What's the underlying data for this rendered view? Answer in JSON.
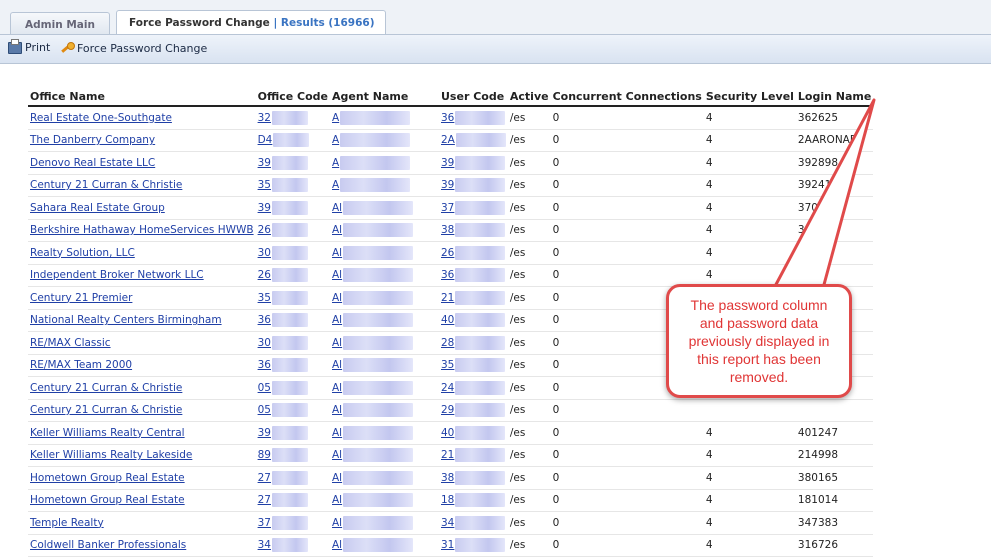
{
  "tabs": [
    {
      "label": "Admin Main"
    },
    {
      "label": "Force Password Change",
      "results": "| Results (16966)",
      "close": "✕"
    }
  ],
  "toolbar": {
    "print_label": "Print",
    "force_label": "Force Password Change"
  },
  "table": {
    "headers": [
      "Office Name",
      "Office Code",
      "Agent Name",
      "User Code",
      "Active",
      "Concurrent Connections",
      "Security Level",
      "Login Name"
    ],
    "rows": [
      {
        "office": "Real Estate One-Southgate",
        "code": "32",
        "agent": "A",
        "user": "36",
        "active": "/es",
        "conc": "0",
        "sec": "4",
        "login": "362625"
      },
      {
        "office": "The Danberry Company",
        "code": "D4",
        "agent": "A",
        "user": "2A",
        "active": "/es",
        "conc": "0",
        "sec": "4",
        "login": "2AARONAD"
      },
      {
        "office": "Denovo Real Estate LLC",
        "code": "39",
        "agent": "A",
        "user": "39",
        "active": "/es",
        "conc": "0",
        "sec": "4",
        "login": "392898"
      },
      {
        "office": "Century 21 Curran & Christie",
        "code": "35",
        "agent": "A",
        "user": "39",
        "active": "/es",
        "conc": "0",
        "sec": "4",
        "login": "392415"
      },
      {
        "office": "Sahara Real Estate Group",
        "code": "39",
        "agent": "Al",
        "user": "37",
        "active": "/es",
        "conc": "0",
        "sec": "4",
        "login": "370635"
      },
      {
        "office": "Berkshire Hathaway HomeServices HWWB",
        "code": "26",
        "agent": "Al",
        "user": "38",
        "active": "/es",
        "conc": "0",
        "sec": "4",
        "login": "3868"
      },
      {
        "office": "Realty Solution, LLC",
        "code": "30",
        "agent": "Al",
        "user": "26",
        "active": "/es",
        "conc": "0",
        "sec": "4",
        "login": "26"
      },
      {
        "office": "Independent Broker Network LLC",
        "code": "26",
        "agent": "Al",
        "user": "36",
        "active": "/es",
        "conc": "0",
        "sec": "4",
        "login": ""
      },
      {
        "office": "Century 21 Premier",
        "code": "35",
        "agent": "Al",
        "user": "21",
        "active": "/es",
        "conc": "0",
        "sec": "",
        "login": ""
      },
      {
        "office": "National Realty Centers Birmingham",
        "code": "36",
        "agent": "Al",
        "user": "40",
        "active": "/es",
        "conc": "0",
        "sec": "",
        "login": ""
      },
      {
        "office": "RE/MAX Classic",
        "code": "30",
        "agent": "Al",
        "user": "28",
        "active": "/es",
        "conc": "0",
        "sec": "",
        "login": ""
      },
      {
        "office": "RE/MAX Team 2000",
        "code": "36",
        "agent": "Al",
        "user": "35",
        "active": "/es",
        "conc": "0",
        "sec": "",
        "login": ""
      },
      {
        "office": "Century 21 Curran & Christie",
        "code": "05",
        "agent": "Al",
        "user": "24",
        "active": "/es",
        "conc": "0",
        "sec": "",
        "login": ""
      },
      {
        "office": "Century 21 Curran & Christie",
        "code": "05",
        "agent": "Al",
        "user": "29",
        "active": "/es",
        "conc": "0",
        "sec": "",
        "login": ""
      },
      {
        "office": "Keller Williams Realty Central",
        "code": "39",
        "agent": "Al",
        "user": "40",
        "active": "/es",
        "conc": "0",
        "sec": "4",
        "login": "401247"
      },
      {
        "office": "Keller Williams Realty Lakeside",
        "code": "89",
        "agent": "Al",
        "user": "21",
        "active": "/es",
        "conc": "0",
        "sec": "4",
        "login": "214998"
      },
      {
        "office": "Hometown Group Real Estate",
        "code": "27",
        "agent": "Al",
        "user": "38",
        "active": "/es",
        "conc": "0",
        "sec": "4",
        "login": "380165"
      },
      {
        "office": "Hometown Group Real Estate",
        "code": "27",
        "agent": "Al",
        "user": "18",
        "active": "/es",
        "conc": "0",
        "sec": "4",
        "login": "181014"
      },
      {
        "office": "Temple Realty",
        "code": "37",
        "agent": "Al",
        "user": "34",
        "active": "/es",
        "conc": "0",
        "sec": "4",
        "login": "347383"
      },
      {
        "office": "Coldwell Banker Professionals",
        "code": "34",
        "agent": "Al",
        "user": "31",
        "active": "/es",
        "conc": "0",
        "sec": "4",
        "login": "316726"
      }
    ]
  },
  "callout": {
    "text": "The password column and password data previously displayed in this report has been removed."
  },
  "colors": {
    "link": "#1f3fa6",
    "callout_border": "#e04a4a",
    "callout_text": "#e03535",
    "tab_close": "#d6222a",
    "results_text": "#3a74c2"
  }
}
